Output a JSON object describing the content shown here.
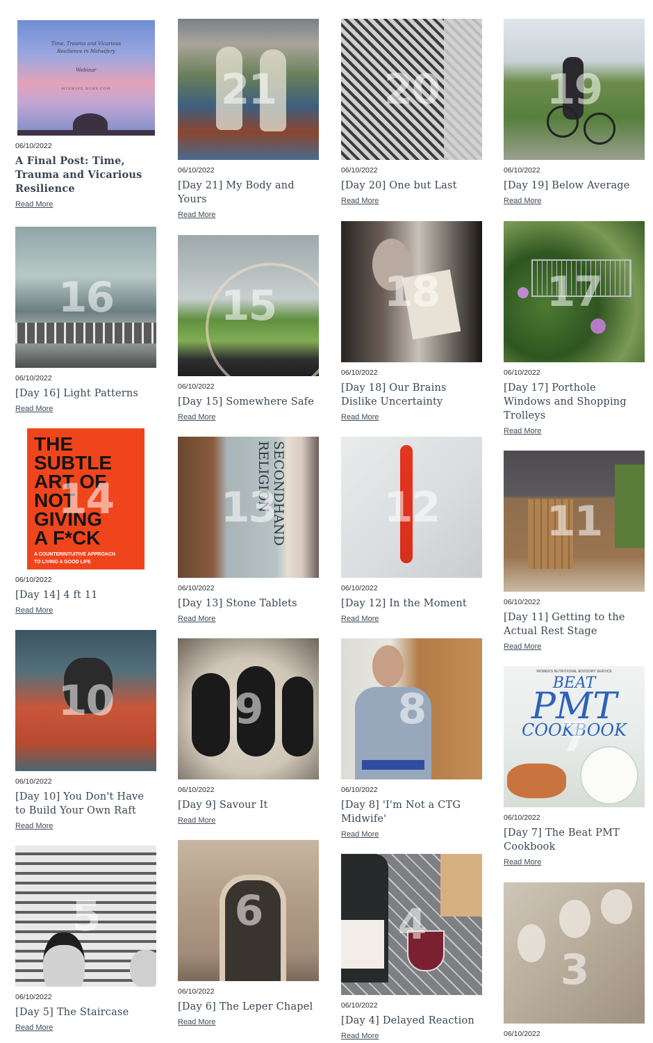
{
  "read_more": "Read More",
  "posts": [
    {
      "day_number": "",
      "date": "06/10/2022",
      "title": "A Final Post: Time, Trauma and Vicarious Resilience",
      "thumb_text": {
        "line1": "Time, Trauma and Vicarious",
        "line2": "Resilience in Midwifery",
        "line3": "Webinar",
        "line4": "MIDWIFE.BURY.COM"
      }
    },
    {
      "day_number": "21",
      "date": "06/10/2022",
      "title": "[Day 21] My Body and Yours"
    },
    {
      "day_number": "20",
      "date": "06/10/2022",
      "title": "[Day 20] One but Last"
    },
    {
      "day_number": "19",
      "date": "06/10/2022",
      "title": "[Day 19] Below Average"
    },
    {
      "day_number": "16",
      "date": "06/10/2022",
      "title": "[Day 16] Light Patterns"
    },
    {
      "day_number": "15",
      "date": "06/10/2022",
      "title": "[Day 15] Somewhere Safe"
    },
    {
      "day_number": "18",
      "date": "06/10/2022",
      "title": "[Day 18] Our Brains Dislike Uncertainty"
    },
    {
      "day_number": "17",
      "date": "06/10/2022",
      "title": "[Day 17] Porthole Windows and Shopping Trolleys"
    },
    {
      "day_number": "14",
      "date": "06/10/2022",
      "title": "[Day 14] 4 ft 11",
      "thumb_text": {
        "l1": "THE",
        "l2": "SUBTLE",
        "l3": "ART OF",
        "l4": "NOT",
        "l5": "GIVING",
        "l6": "A F*CK",
        "sub1": "A COUNTERINTUITIVE APPROACH",
        "sub2": "TO LIVING A GOOD LIFE"
      }
    },
    {
      "day_number": "13",
      "date": "06/10/2022",
      "title": "[Day 13] Stone Tablets",
      "thumb_text": {
        "spine": "SECONDHAND RELIGION"
      }
    },
    {
      "day_number": "12",
      "date": "06/10/2022",
      "title": "[Day 12] In the Moment"
    },
    {
      "day_number": "11",
      "date": "06/10/2022",
      "title": "[Day 11] Getting to the Actual Rest Stage"
    },
    {
      "day_number": "10",
      "date": "06/10/2022",
      "title": "[Day 10] You Don't Have to Build Your Own Raft"
    },
    {
      "day_number": "9",
      "date": "06/10/2022",
      "title": "[Day 9] Savour It"
    },
    {
      "day_number": "8",
      "date": "06/10/2022",
      "title": "[Day 8] 'I'm Not a CTG Midwife'"
    },
    {
      "day_number": "7",
      "date": "06/10/2022",
      "title": "[Day 7] The Beat PMT Cookbook",
      "thumb_text": {
        "top": "WOMEN'S NUTRITIONAL ADVISORY SERVICE",
        "beat": "BEAT",
        "pmt": "PMT",
        "cookbook": "COOKBOOK"
      }
    },
    {
      "day_number": "5",
      "date": "06/10/2022",
      "title": "[Day 5] The Staircase"
    },
    {
      "day_number": "6",
      "date": "06/10/2022",
      "title": "[Day 6] The Leper Chapel"
    },
    {
      "day_number": "4",
      "date": "06/10/2022",
      "title": "[Day 4] Delayed Reaction"
    },
    {
      "day_number": "3",
      "date": "06/10/2022",
      "title": ""
    }
  ],
  "colors": {
    "title": "#3a4552",
    "link": "#3f4a57",
    "date": "#2b2b2b",
    "background": "#ffffff"
  }
}
